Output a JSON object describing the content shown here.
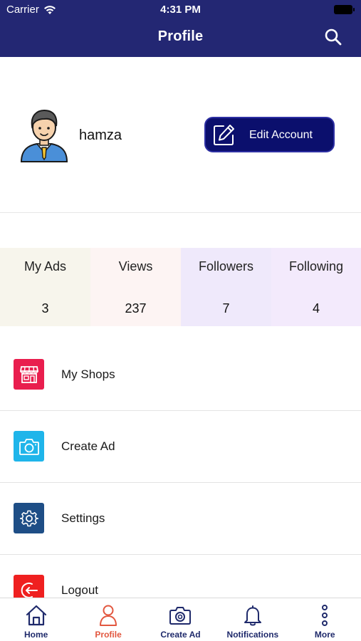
{
  "status_bar": {
    "carrier": "Carrier",
    "time": "4:31 PM"
  },
  "header": {
    "title": "Profile",
    "search_icon": "search-icon",
    "color": "#232773"
  },
  "profile": {
    "username": "hamza",
    "avatar_icon": "avatar-man-icon",
    "edit_button": {
      "label": "Edit Account",
      "icon": "edit-icon",
      "color": "#0b0f6d"
    }
  },
  "stats": [
    {
      "label": "My Ads",
      "value": "3",
      "bg": "#f7f5ec"
    },
    {
      "label": "Views",
      "value": "237",
      "bg": "#fdf4f3"
    },
    {
      "label": "Followers",
      "value": "7",
      "bg": "#efe9fb"
    },
    {
      "label": "Following",
      "value": "4",
      "bg": "#f3eafc"
    }
  ],
  "menu": [
    {
      "label": "My Shops",
      "icon": "shop-icon",
      "color": "#e91e4e"
    },
    {
      "label": "Create Ad",
      "icon": "camera-icon",
      "color": "#1fb5ea"
    },
    {
      "label": "Settings",
      "icon": "gear-icon",
      "color": "#1e4e86"
    },
    {
      "label": "Logout",
      "icon": "logout-icon",
      "color": "#ef2020"
    }
  ],
  "tabbar": {
    "active_color": "#e2573f",
    "inactive_color": "#1f2a6b",
    "tabs": [
      {
        "label": "Home",
        "icon": "home-icon"
      },
      {
        "label": "Profile",
        "icon": "person-icon"
      },
      {
        "label": "Create Ad",
        "icon": "camera-icon"
      },
      {
        "label": "Notifications",
        "icon": "bell-icon"
      },
      {
        "label": "More",
        "icon": "more-vertical-icon"
      }
    ]
  }
}
